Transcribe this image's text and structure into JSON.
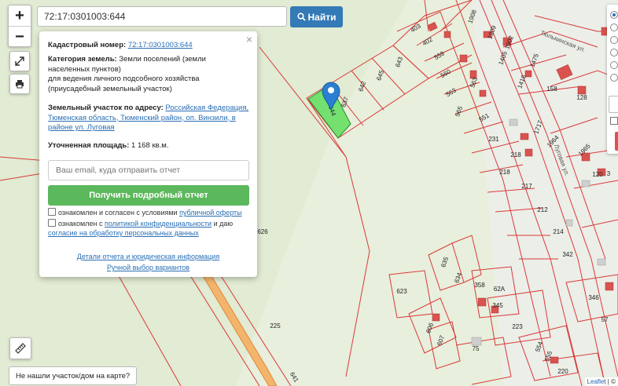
{
  "search": {
    "value": "72:17:0301003:644",
    "button_label": "Найти"
  },
  "zoom": {
    "in": "+",
    "out": "−"
  },
  "icons": {
    "expand": "expand-icon",
    "print": "print-icon",
    "ruler": "ruler-icon",
    "search": "search-icon",
    "marker": "map-marker-icon"
  },
  "popup": {
    "cadastral_label": "Кадастровый номер:",
    "cadastral_value": "72:17:0301003:644",
    "category_label": "Категория земель:",
    "category_value": "Земли поселений (земли населенных пунктов)",
    "usage": "для ведения личного подсобного хозяйства (приусадебный земельный участок)",
    "address_label": "Земельный участок по адресу:",
    "address_value": "Российская Федерация, Тюменская область, Тюменский район, оп. Винзили, в районе ул. Луговая",
    "area_label": "Уточненная площадь:",
    "area_value": "1 168 кв.м.",
    "email_placeholder": "Ваш email, куда отправить отчет",
    "get_report_button": "Получить подробный отчет",
    "consent1_pre": "ознакомлен и согласен с условиями ",
    "consent1_link": "публичной оферты",
    "consent2_pre": "ознакомлен с ",
    "consent2_link": "политикой конфиденциальности",
    "consent2_mid": " и даю ",
    "consent2_link2": "согласие на обработку персональных данных",
    "details_link": "Детали отчета и юридическая информация",
    "manual_link": "Ручной выбор вариантов",
    "close": "×"
  },
  "bottom_note": "Не нашли участок/дом на карте?",
  "attribution": {
    "leaflet": "Leaflet",
    "sep": " | ©"
  },
  "map_labels": [
    {
      "text": "403"
    },
    {
      "text": "1908"
    },
    {
      "text": "402"
    },
    {
      "text": "1909"
    },
    {
      "text": "559"
    },
    {
      "text": "1902"
    },
    {
      "text": "1405"
    },
    {
      "text": "1475"
    },
    {
      "text": "Тюлькинская ул."
    },
    {
      "text": "560"
    },
    {
      "text": "1416"
    },
    {
      "text": "158"
    },
    {
      "text": "128"
    },
    {
      "text": "563"
    },
    {
      "text": "563"
    },
    {
      "text": "565"
    },
    {
      "text": "551"
    },
    {
      "text": "1717"
    },
    {
      "text": "1964"
    },
    {
      "text": "231"
    },
    {
      "text": "1965"
    },
    {
      "text": "218"
    },
    {
      "text": "218"
    },
    {
      "text": "Луговая ул."
    },
    {
      "text": "120"
    },
    {
      "text": "217"
    },
    {
      "text": "212"
    },
    {
      "text": "214"
    },
    {
      "text": "342"
    },
    {
      "text": "645"
    },
    {
      "text": "642"
    },
    {
      "text": "643"
    },
    {
      "text": "637"
    },
    {
      "text": "644"
    },
    {
      "text": "626"
    },
    {
      "text": "635"
    },
    {
      "text": "634"
    },
    {
      "text": "623"
    },
    {
      "text": "358"
    },
    {
      "text": "62А"
    },
    {
      "text": "345"
    },
    {
      "text": "346"
    },
    {
      "text": "606"
    },
    {
      "text": "607"
    },
    {
      "text": "223"
    },
    {
      "text": "554"
    },
    {
      "text": "555"
    },
    {
      "text": "225"
    },
    {
      "text": "220"
    },
    {
      "text": "57"
    },
    {
      "text": "641"
    },
    {
      "text": "75"
    },
    {
      "text": "3"
    }
  ],
  "colors": {
    "parcel_line": "#d93a3a",
    "selected_fill": "#61d561",
    "road": "#f0a050",
    "button_blue": "#337ab7",
    "button_green": "#5cb85c"
  }
}
